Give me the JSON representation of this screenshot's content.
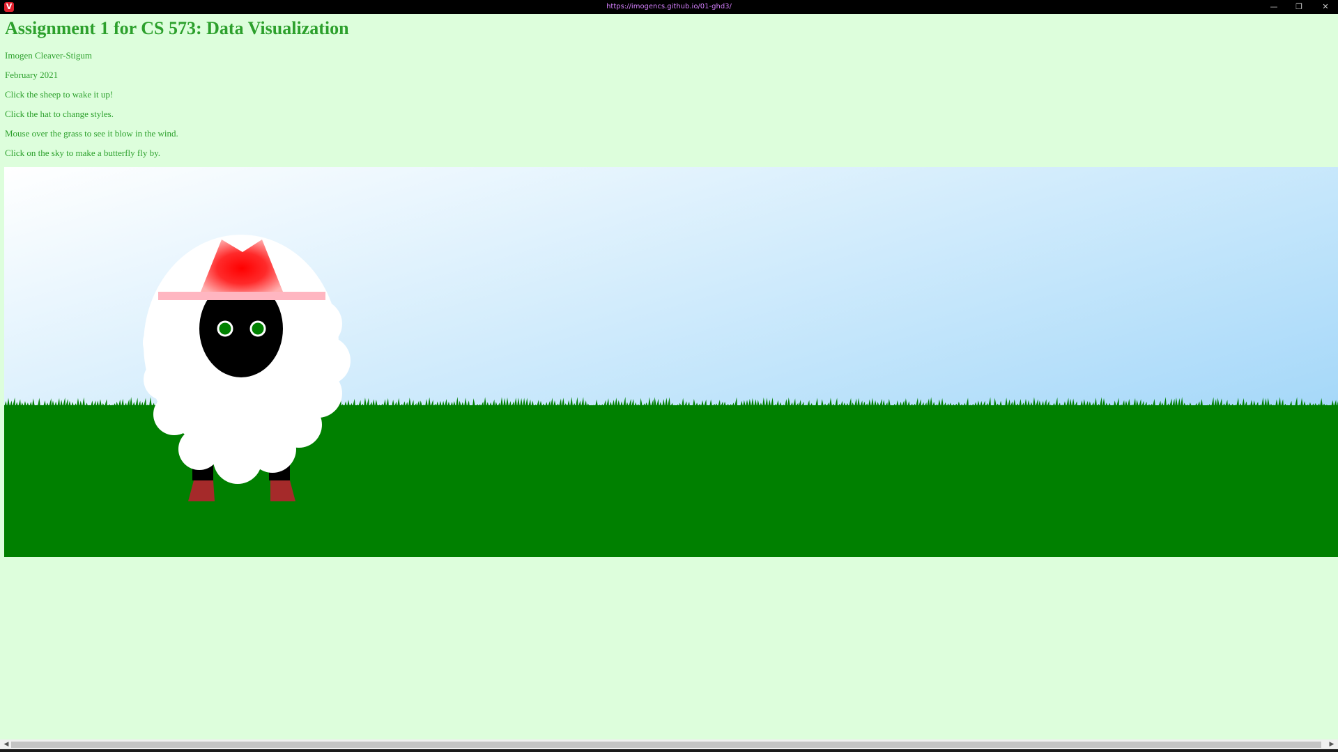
{
  "browser": {
    "url": "https://imogencs.github.io/01-ghd3/",
    "app_icon": "V",
    "minimize_icon": "minimize-icon",
    "restore_icon": "restore-icon",
    "close_icon": "close-icon"
  },
  "page": {
    "title": "Assignment 1 for CS 573: Data Visualization",
    "author": "Imogen Cleaver-Stigum",
    "date": "February 2021",
    "instructions": [
      "Click the sheep to wake it up!",
      "Click the hat to change styles.",
      "Mouse over the grass to see it blow in the wind.",
      "Click on the sky to make a butterfly fly by."
    ]
  },
  "colors": {
    "page_bg": "#ddfedc",
    "text": "#2ca02c",
    "grass": "#008000",
    "sky_top": "#ffffff",
    "sky_bottom": "#9dd4f8",
    "hat": "#ff0000",
    "hat_brim": "#ffb6c1",
    "shoes": "#a52a2a"
  }
}
